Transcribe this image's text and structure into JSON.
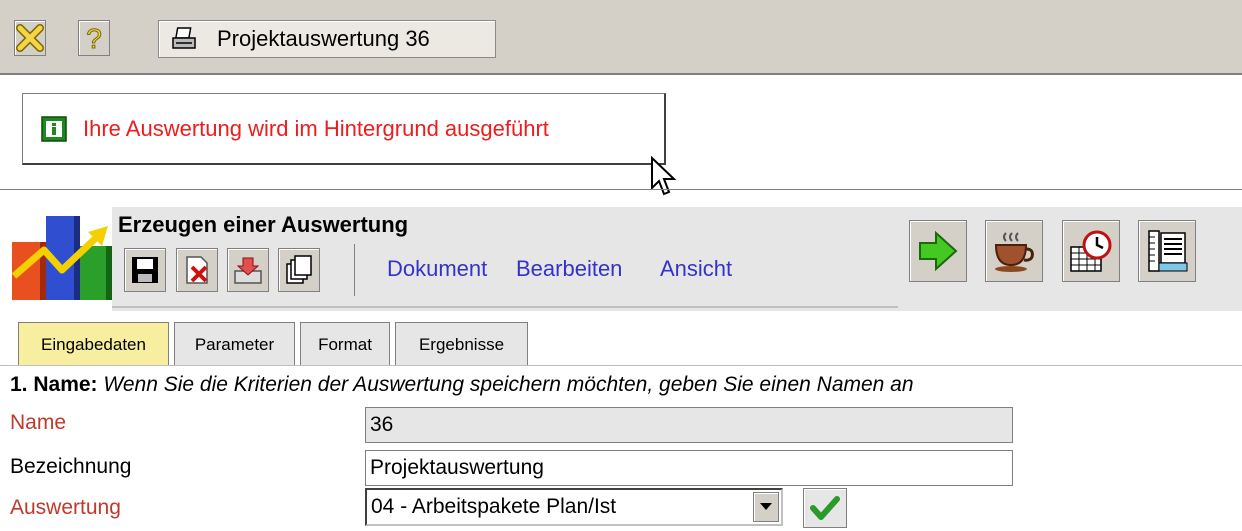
{
  "toolbar": {
    "close_icon": "close-icon",
    "help_icon": "help-icon",
    "window_tab": {
      "icon": "printer-icon",
      "label": "Projektauswertung 36"
    }
  },
  "message": {
    "icon": "info-icon",
    "text": "Ihre Auswertung wird im Hintergrund ausgeführt"
  },
  "panel": {
    "title": "Erzeugen einer Auswertung",
    "logo_icon": "chart-logo-icon",
    "small_buttons": [
      "save-icon",
      "delete-icon",
      "import-icon",
      "copy-icon"
    ],
    "menu": [
      "Dokument",
      "Bearbeiten",
      "Ansicht"
    ],
    "big_buttons": [
      "execute-arrow-icon",
      "coffee-cup-icon",
      "schedule-clock-icon",
      "report-layout-icon"
    ]
  },
  "tabs": [
    {
      "label": "Eingabedaten",
      "active": true
    },
    {
      "label": "Parameter",
      "active": false
    },
    {
      "label": "Format",
      "active": false
    },
    {
      "label": "Ergebnisse",
      "active": false
    }
  ],
  "section": {
    "number": "1. Name:",
    "hint": "Wenn Sie die Kriterien der Auswertung speichern möchten, geben Sie einen Namen an"
  },
  "form": {
    "name_label": "Name",
    "name_value": "36",
    "desc_label": "Bezeichnung",
    "desc_value": "Projektauswertung",
    "eval_label": "Auswertung",
    "eval_value": "04 - Arbeitspakete Plan/Ist"
  },
  "colors": {
    "required_label": "#c0392b",
    "message_text": "#ee1c1c",
    "menu_link": "#3333cc",
    "active_tab": "#f7eea0"
  }
}
